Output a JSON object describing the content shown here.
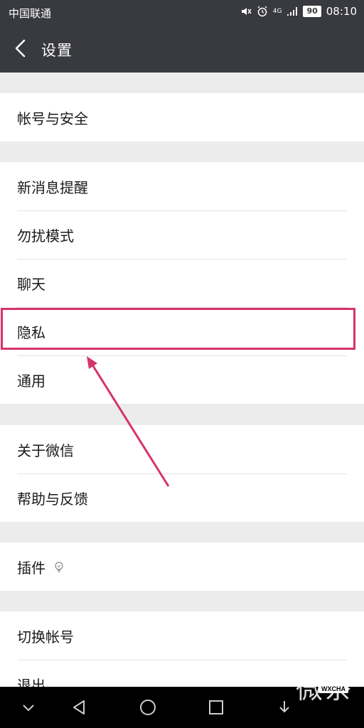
{
  "status_bar": {
    "carrier": "中国联通",
    "network": "4G",
    "battery": "90",
    "time": "08:10"
  },
  "header": {
    "title": "设置"
  },
  "groups": [
    {
      "items": [
        {
          "label": "帐号与安全"
        }
      ]
    },
    {
      "items": [
        {
          "label": "新消息提醒"
        },
        {
          "label": "勿扰模式"
        },
        {
          "label": "聊天"
        },
        {
          "label": "隐私"
        },
        {
          "label": "通用"
        }
      ]
    },
    {
      "items": [
        {
          "label": "关于微信"
        },
        {
          "label": "帮助与反馈"
        }
      ]
    },
    {
      "items": [
        {
          "label": "插件"
        }
      ]
    },
    {
      "items": [
        {
          "label": "切换帐号"
        },
        {
          "label": "退出"
        }
      ]
    }
  ],
  "annotation": {
    "highlighted_item": "隐私",
    "color": "#d6336c"
  },
  "watermark": {
    "text": "微茶",
    "badge": "WXCHA"
  },
  "colors": {
    "title_bar": "#393a3f",
    "background": "#ececec",
    "highlight": "#d6336c"
  }
}
